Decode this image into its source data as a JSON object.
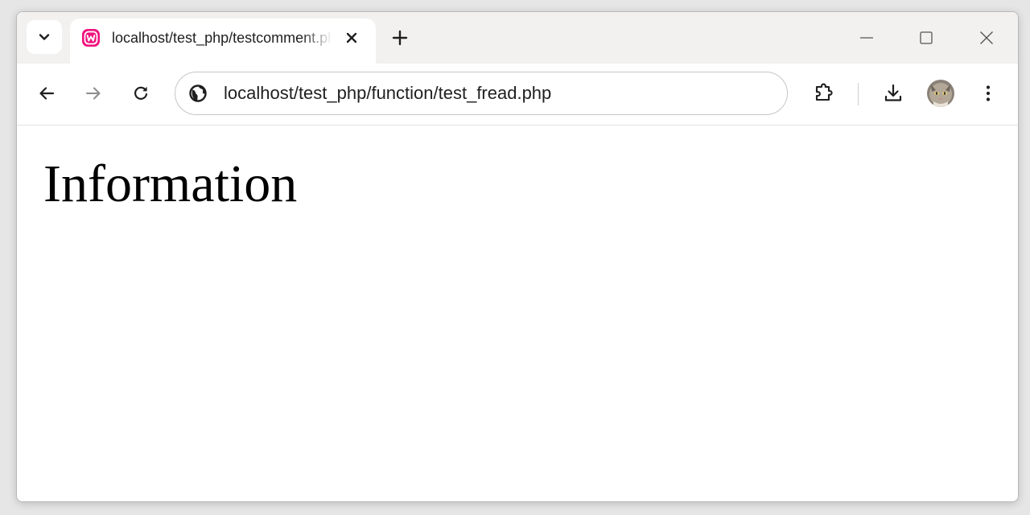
{
  "colors": {
    "accent": "#f0127d",
    "tab_strip_bg": "#f2f1f0",
    "icon_color": "#1f1f1f",
    "disabled_icon_color": "#8c8c8c"
  },
  "tab_strip": {
    "tab_list_icon": "chevron-down-icon",
    "tabs": [
      {
        "title": "localhost/test_php/testcomment.php",
        "favicon": "wampserver-logo-icon",
        "close_icon": "close-icon",
        "active": true
      }
    ],
    "new_tab_icon": "plus-icon",
    "window_controls": [
      "minimize-icon",
      "maximize-icon",
      "close-icon"
    ]
  },
  "toolbar": {
    "back_icon": "arrow-left-icon",
    "forward_icon": "arrow-right-icon",
    "forward_disabled": true,
    "reload_icon": "reload-icon",
    "site_info_icon": "globe-icon",
    "url": "localhost/test_php/function/test_fread.php",
    "extensions_icon": "puzzle-icon",
    "downloads_icon": "download-icon",
    "profile_icon": "avatar",
    "menu_icon": "kebab-menu-icon"
  },
  "page": {
    "heading": "Information"
  }
}
